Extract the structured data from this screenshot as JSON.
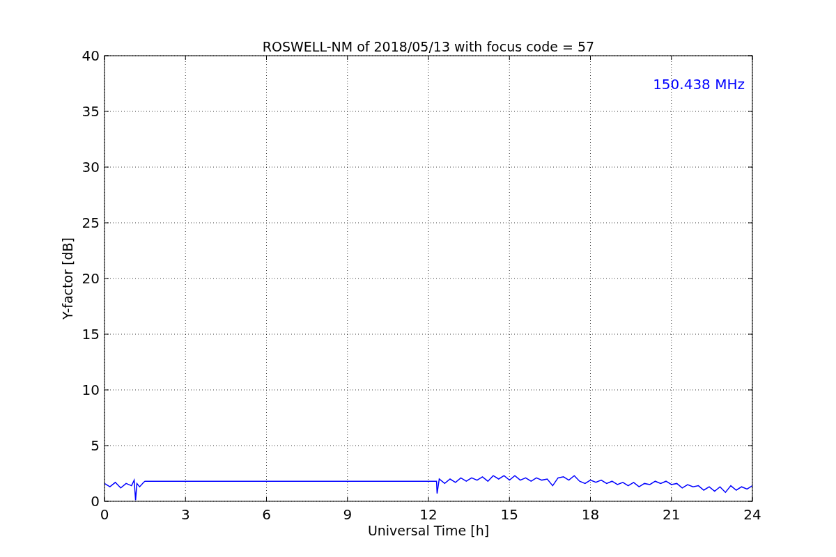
{
  "chart_data": {
    "type": "line",
    "title": "ROSWELL-NM of 2018/05/13 with focus code = 57",
    "xlabel": "Universal Time [h]",
    "ylabel": "Y-factor [dB]",
    "x": [
      0,
      0.2,
      0.4,
      0.6,
      0.8,
      1.0,
      1.1,
      1.15,
      1.2,
      1.3,
      1.45,
      1.5,
      12.3,
      12.32,
      12.4,
      12.6,
      12.8,
      13.0,
      13.2,
      13.4,
      13.6,
      13.8,
      14.0,
      14.2,
      14.4,
      14.6,
      14.8,
      15.0,
      15.2,
      15.4,
      15.6,
      15.8,
      16.0,
      16.2,
      16.4,
      16.6,
      16.8,
      17.0,
      17.2,
      17.4,
      17.6,
      17.8,
      18.0,
      18.2,
      18.4,
      18.6,
      18.8,
      19.0,
      19.2,
      19.4,
      19.6,
      19.8,
      20.0,
      20.2,
      20.4,
      20.6,
      20.8,
      21.0,
      21.2,
      21.4,
      21.6,
      21.8,
      22.0,
      22.2,
      22.4,
      22.6,
      22.8,
      23.0,
      23.2,
      23.4,
      23.6,
      23.8,
      24.0
    ],
    "series": [
      {
        "name": "150.438 MHz",
        "color": "#0000ff",
        "values": [
          1.6,
          1.3,
          1.7,
          1.2,
          1.6,
          1.4,
          1.9,
          0.1,
          1.6,
          1.3,
          1.7,
          1.8,
          1.8,
          0.7,
          2.0,
          1.6,
          2.0,
          1.7,
          2.1,
          1.8,
          2.1,
          1.9,
          2.2,
          1.8,
          2.3,
          2.0,
          2.3,
          1.9,
          2.3,
          1.9,
          2.1,
          1.8,
          2.1,
          1.9,
          2.0,
          1.4,
          2.1,
          2.2,
          1.9,
          2.3,
          1.8,
          1.6,
          1.9,
          1.7,
          1.9,
          1.6,
          1.8,
          1.5,
          1.7,
          1.4,
          1.7,
          1.3,
          1.6,
          1.5,
          1.8,
          1.6,
          1.8,
          1.5,
          1.6,
          1.2,
          1.5,
          1.3,
          1.4,
          1.0,
          1.3,
          0.9,
          1.3,
          0.8,
          1.4,
          1.0,
          1.3,
          1.1,
          1.4
        ]
      }
    ],
    "xlim": [
      0,
      24
    ],
    "ylim": [
      0,
      40
    ],
    "xticks": [
      0,
      3,
      6,
      9,
      12,
      15,
      18,
      21,
      24
    ],
    "yticks": [
      0,
      5,
      10,
      15,
      20,
      25,
      30,
      35,
      40
    ],
    "grid": true
  }
}
